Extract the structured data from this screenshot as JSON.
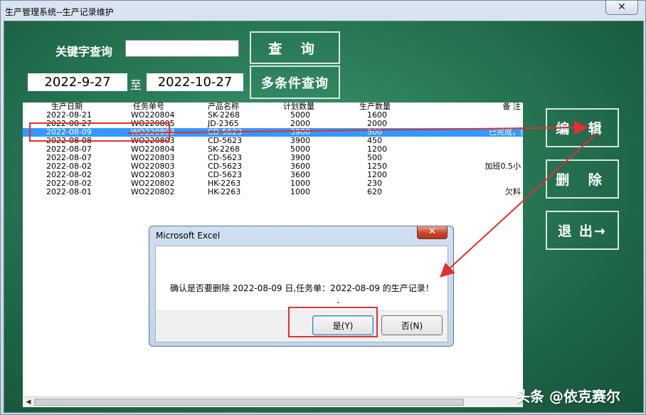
{
  "window": {
    "title": "生产管理系统--生产记录维护",
    "close_glyph": "✕"
  },
  "search": {
    "keyword_label": "关键字查询",
    "keyword_value": "",
    "query_button": "查 询",
    "multi_button": "多条件查询",
    "date_from": "2022-9-27",
    "to_label": "至",
    "date_to": "2022-10-27"
  },
  "actions": {
    "edit": "编 辑",
    "delete": "删 除",
    "exit": "退 出→"
  },
  "table": {
    "headers": [
      "生产日期",
      "任务单号",
      "产品名称",
      "计划数量",
      "生产数量",
      "备 注"
    ],
    "rows": [
      [
        "2022-08-21",
        "WO220804",
        "SK-2268",
        "5000",
        "1600",
        ""
      ],
      [
        "2022-08-27",
        "WO220805",
        "JD-2365",
        "2000",
        "2000",
        ""
      ],
      [
        "2022-08-09",
        "WO220803",
        "CD-5623",
        "3900",
        "500",
        "已完成，已报"
      ],
      [
        "2022-08-08",
        "WO220803",
        "CD-5623",
        "3900",
        "450",
        ""
      ],
      [
        "2022-08-07",
        "WO220804",
        "SK-2268",
        "5000",
        "1200",
        ""
      ],
      [
        "2022-08-07",
        "WO220803",
        "CD-5623",
        "3900",
        "500",
        ""
      ],
      [
        "2022-08-02",
        "WO220803",
        "CD-5623",
        "3600",
        "1250",
        "加班0.5小"
      ],
      [
        "2022-08-02",
        "WO220803",
        "CD-5623",
        "3600",
        "1200",
        ""
      ],
      [
        "2022-08-02",
        "WO220802",
        "HK-2263",
        "1000",
        "230",
        ""
      ],
      [
        "2022-08-01",
        "WO220802",
        "HK-2263",
        "1000",
        "620",
        "欠料"
      ]
    ],
    "selected_index": 2
  },
  "dialog": {
    "title": "Microsoft Excel",
    "close_glyph": "✕",
    "message": "确认是否要删除 2022-08-09 日,任务单：2022-08-09 的生产记录！",
    "yes": "是(Y)",
    "no": "否(N)"
  },
  "watermark": "头条 @依克赛尔",
  "colors": {
    "green": "#2a7b57",
    "selection": "#3399ff",
    "annotation": "#e03030"
  }
}
